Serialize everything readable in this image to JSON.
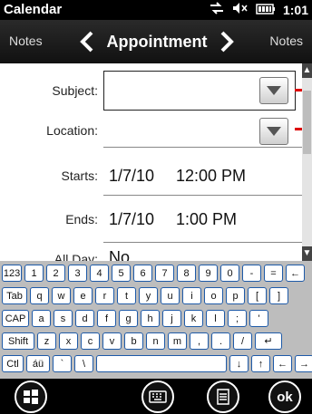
{
  "status_bar": {
    "app_title": "Calendar",
    "time": "1:01",
    "icons": [
      "connectivity-icon",
      "volume-muted-icon",
      "battery-icon"
    ]
  },
  "nav": {
    "left_label": "Notes",
    "title": "Appointment",
    "right_label": "Notes"
  },
  "form": {
    "subject": {
      "label": "Subject:",
      "value": ""
    },
    "location": {
      "label": "Location:",
      "value": ""
    },
    "starts": {
      "label": "Starts:",
      "date": "1/7/10",
      "time": "12:00 PM"
    },
    "ends": {
      "label": "Ends:",
      "date": "1/7/10",
      "time": "1:00 PM"
    },
    "all_day": {
      "label": "All Day:",
      "value": "No"
    }
  },
  "keyboard": {
    "rows": [
      [
        "123",
        "1",
        "2",
        "3",
        "4",
        "5",
        "6",
        "7",
        "8",
        "9",
        "0",
        "-",
        "=",
        "←"
      ],
      [
        "Tab",
        "q",
        "w",
        "e",
        "r",
        "t",
        "y",
        "u",
        "i",
        "o",
        "p",
        "[",
        "]"
      ],
      [
        "CAP",
        "a",
        "s",
        "d",
        "f",
        "g",
        "h",
        "j",
        "k",
        "l",
        ";",
        "'"
      ],
      [
        "Shift",
        "z",
        "x",
        "c",
        "v",
        "b",
        "n",
        "m",
        ",",
        ".",
        "/",
        "↵"
      ],
      [
        "Ctl",
        "áü",
        "`",
        "\\",
        " ",
        "↓",
        "↑",
        "←",
        "→"
      ]
    ]
  },
  "bottom_bar": {
    "ok_label": "ok",
    "buttons": [
      "windows-start-icon",
      "keyboard-icon",
      "menu-icon",
      "ok-button"
    ]
  },
  "colors": {
    "key_border": "#1e5aa8",
    "marker": "#dd0000"
  }
}
